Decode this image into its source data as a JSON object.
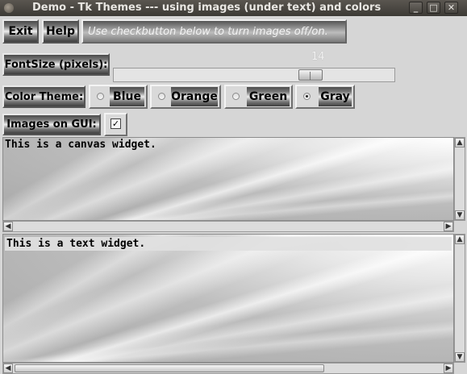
{
  "window": {
    "title": "Demo - Tk Themes --- using images (under text) and colors",
    "controls": {
      "minimize": "_",
      "maximize": "□",
      "close": "✕"
    }
  },
  "toolbar": {
    "exit_label": "Exit",
    "help_label": "Help",
    "hint_text": "Use checkbutton below to turn images off/on."
  },
  "fontsize": {
    "label": "FontSize (pixels):",
    "value": "14",
    "slider_fraction": 0.72
  },
  "color_theme": {
    "label": "Color Theme:",
    "options": [
      {
        "label": "Blue",
        "selected": false
      },
      {
        "label": "Orange",
        "selected": false
      },
      {
        "label": "Green",
        "selected": false
      },
      {
        "label": "Gray",
        "selected": true
      }
    ]
  },
  "images": {
    "label": "Images on GUI:",
    "checked": true,
    "check_glyph": "✓"
  },
  "canvas": {
    "text": "This is a canvas widget."
  },
  "textwidget": {
    "text": "This is a text widget."
  },
  "scroll_arrows": {
    "up": "▲",
    "down": "▼",
    "left": "◀",
    "right": "▶"
  }
}
